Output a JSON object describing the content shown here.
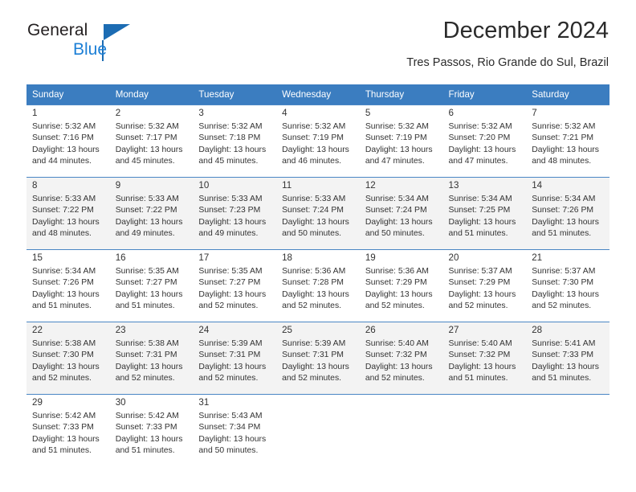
{
  "brand": {
    "name_part1": "General",
    "name_part2": "Blue",
    "triangle_color": "#1c6cb3",
    "blue_color": "#1c7fd6"
  },
  "header": {
    "title": "December 2024",
    "subtitle": "Tres Passos, Rio Grande do Sul, Brazil"
  },
  "theme": {
    "header_bg": "#3b7dc0",
    "header_text": "#ffffff",
    "row_alt_bg": "#f3f3f3",
    "grid_line": "#4a86c4"
  },
  "calendar": {
    "weekday_headers": [
      "Sunday",
      "Monday",
      "Tuesday",
      "Wednesday",
      "Thursday",
      "Friday",
      "Saturday"
    ],
    "weeks": [
      [
        {
          "day": "1",
          "sunrise": "Sunrise: 5:32 AM",
          "sunset": "Sunset: 7:16 PM",
          "daylight1": "Daylight: 13 hours",
          "daylight2": "and 44 minutes."
        },
        {
          "day": "2",
          "sunrise": "Sunrise: 5:32 AM",
          "sunset": "Sunset: 7:17 PM",
          "daylight1": "Daylight: 13 hours",
          "daylight2": "and 45 minutes."
        },
        {
          "day": "3",
          "sunrise": "Sunrise: 5:32 AM",
          "sunset": "Sunset: 7:18 PM",
          "daylight1": "Daylight: 13 hours",
          "daylight2": "and 45 minutes."
        },
        {
          "day": "4",
          "sunrise": "Sunrise: 5:32 AM",
          "sunset": "Sunset: 7:19 PM",
          "daylight1": "Daylight: 13 hours",
          "daylight2": "and 46 minutes."
        },
        {
          "day": "5",
          "sunrise": "Sunrise: 5:32 AM",
          "sunset": "Sunset: 7:19 PM",
          "daylight1": "Daylight: 13 hours",
          "daylight2": "and 47 minutes."
        },
        {
          "day": "6",
          "sunrise": "Sunrise: 5:32 AM",
          "sunset": "Sunset: 7:20 PM",
          "daylight1": "Daylight: 13 hours",
          "daylight2": "and 47 minutes."
        },
        {
          "day": "7",
          "sunrise": "Sunrise: 5:32 AM",
          "sunset": "Sunset: 7:21 PM",
          "daylight1": "Daylight: 13 hours",
          "daylight2": "and 48 minutes."
        }
      ],
      [
        {
          "day": "8",
          "sunrise": "Sunrise: 5:33 AM",
          "sunset": "Sunset: 7:22 PM",
          "daylight1": "Daylight: 13 hours",
          "daylight2": "and 48 minutes."
        },
        {
          "day": "9",
          "sunrise": "Sunrise: 5:33 AM",
          "sunset": "Sunset: 7:22 PM",
          "daylight1": "Daylight: 13 hours",
          "daylight2": "and 49 minutes."
        },
        {
          "day": "10",
          "sunrise": "Sunrise: 5:33 AM",
          "sunset": "Sunset: 7:23 PM",
          "daylight1": "Daylight: 13 hours",
          "daylight2": "and 49 minutes."
        },
        {
          "day": "11",
          "sunrise": "Sunrise: 5:33 AM",
          "sunset": "Sunset: 7:24 PM",
          "daylight1": "Daylight: 13 hours",
          "daylight2": "and 50 minutes."
        },
        {
          "day": "12",
          "sunrise": "Sunrise: 5:34 AM",
          "sunset": "Sunset: 7:24 PM",
          "daylight1": "Daylight: 13 hours",
          "daylight2": "and 50 minutes."
        },
        {
          "day": "13",
          "sunrise": "Sunrise: 5:34 AM",
          "sunset": "Sunset: 7:25 PM",
          "daylight1": "Daylight: 13 hours",
          "daylight2": "and 51 minutes."
        },
        {
          "day": "14",
          "sunrise": "Sunrise: 5:34 AM",
          "sunset": "Sunset: 7:26 PM",
          "daylight1": "Daylight: 13 hours",
          "daylight2": "and 51 minutes."
        }
      ],
      [
        {
          "day": "15",
          "sunrise": "Sunrise: 5:34 AM",
          "sunset": "Sunset: 7:26 PM",
          "daylight1": "Daylight: 13 hours",
          "daylight2": "and 51 minutes."
        },
        {
          "day": "16",
          "sunrise": "Sunrise: 5:35 AM",
          "sunset": "Sunset: 7:27 PM",
          "daylight1": "Daylight: 13 hours",
          "daylight2": "and 51 minutes."
        },
        {
          "day": "17",
          "sunrise": "Sunrise: 5:35 AM",
          "sunset": "Sunset: 7:27 PM",
          "daylight1": "Daylight: 13 hours",
          "daylight2": "and 52 minutes."
        },
        {
          "day": "18",
          "sunrise": "Sunrise: 5:36 AM",
          "sunset": "Sunset: 7:28 PM",
          "daylight1": "Daylight: 13 hours",
          "daylight2": "and 52 minutes."
        },
        {
          "day": "19",
          "sunrise": "Sunrise: 5:36 AM",
          "sunset": "Sunset: 7:29 PM",
          "daylight1": "Daylight: 13 hours",
          "daylight2": "and 52 minutes."
        },
        {
          "day": "20",
          "sunrise": "Sunrise: 5:37 AM",
          "sunset": "Sunset: 7:29 PM",
          "daylight1": "Daylight: 13 hours",
          "daylight2": "and 52 minutes."
        },
        {
          "day": "21",
          "sunrise": "Sunrise: 5:37 AM",
          "sunset": "Sunset: 7:30 PM",
          "daylight1": "Daylight: 13 hours",
          "daylight2": "and 52 minutes."
        }
      ],
      [
        {
          "day": "22",
          "sunrise": "Sunrise: 5:38 AM",
          "sunset": "Sunset: 7:30 PM",
          "daylight1": "Daylight: 13 hours",
          "daylight2": "and 52 minutes."
        },
        {
          "day": "23",
          "sunrise": "Sunrise: 5:38 AM",
          "sunset": "Sunset: 7:31 PM",
          "daylight1": "Daylight: 13 hours",
          "daylight2": "and 52 minutes."
        },
        {
          "day": "24",
          "sunrise": "Sunrise: 5:39 AM",
          "sunset": "Sunset: 7:31 PM",
          "daylight1": "Daylight: 13 hours",
          "daylight2": "and 52 minutes."
        },
        {
          "day": "25",
          "sunrise": "Sunrise: 5:39 AM",
          "sunset": "Sunset: 7:31 PM",
          "daylight1": "Daylight: 13 hours",
          "daylight2": "and 52 minutes."
        },
        {
          "day": "26",
          "sunrise": "Sunrise: 5:40 AM",
          "sunset": "Sunset: 7:32 PM",
          "daylight1": "Daylight: 13 hours",
          "daylight2": "and 52 minutes."
        },
        {
          "day": "27",
          "sunrise": "Sunrise: 5:40 AM",
          "sunset": "Sunset: 7:32 PM",
          "daylight1": "Daylight: 13 hours",
          "daylight2": "and 51 minutes."
        },
        {
          "day": "28",
          "sunrise": "Sunrise: 5:41 AM",
          "sunset": "Sunset: 7:33 PM",
          "daylight1": "Daylight: 13 hours",
          "daylight2": "and 51 minutes."
        }
      ],
      [
        {
          "day": "29",
          "sunrise": "Sunrise: 5:42 AM",
          "sunset": "Sunset: 7:33 PM",
          "daylight1": "Daylight: 13 hours",
          "daylight2": "and 51 minutes."
        },
        {
          "day": "30",
          "sunrise": "Sunrise: 5:42 AM",
          "sunset": "Sunset: 7:33 PM",
          "daylight1": "Daylight: 13 hours",
          "daylight2": "and 51 minutes."
        },
        {
          "day": "31",
          "sunrise": "Sunrise: 5:43 AM",
          "sunset": "Sunset: 7:34 PM",
          "daylight1": "Daylight: 13 hours",
          "daylight2": "and 50 minutes."
        },
        {
          "day": "",
          "sunrise": "",
          "sunset": "",
          "daylight1": "",
          "daylight2": ""
        },
        {
          "day": "",
          "sunrise": "",
          "sunset": "",
          "daylight1": "",
          "daylight2": ""
        },
        {
          "day": "",
          "sunrise": "",
          "sunset": "",
          "daylight1": "",
          "daylight2": ""
        },
        {
          "day": "",
          "sunrise": "",
          "sunset": "",
          "daylight1": "",
          "daylight2": ""
        }
      ]
    ]
  }
}
